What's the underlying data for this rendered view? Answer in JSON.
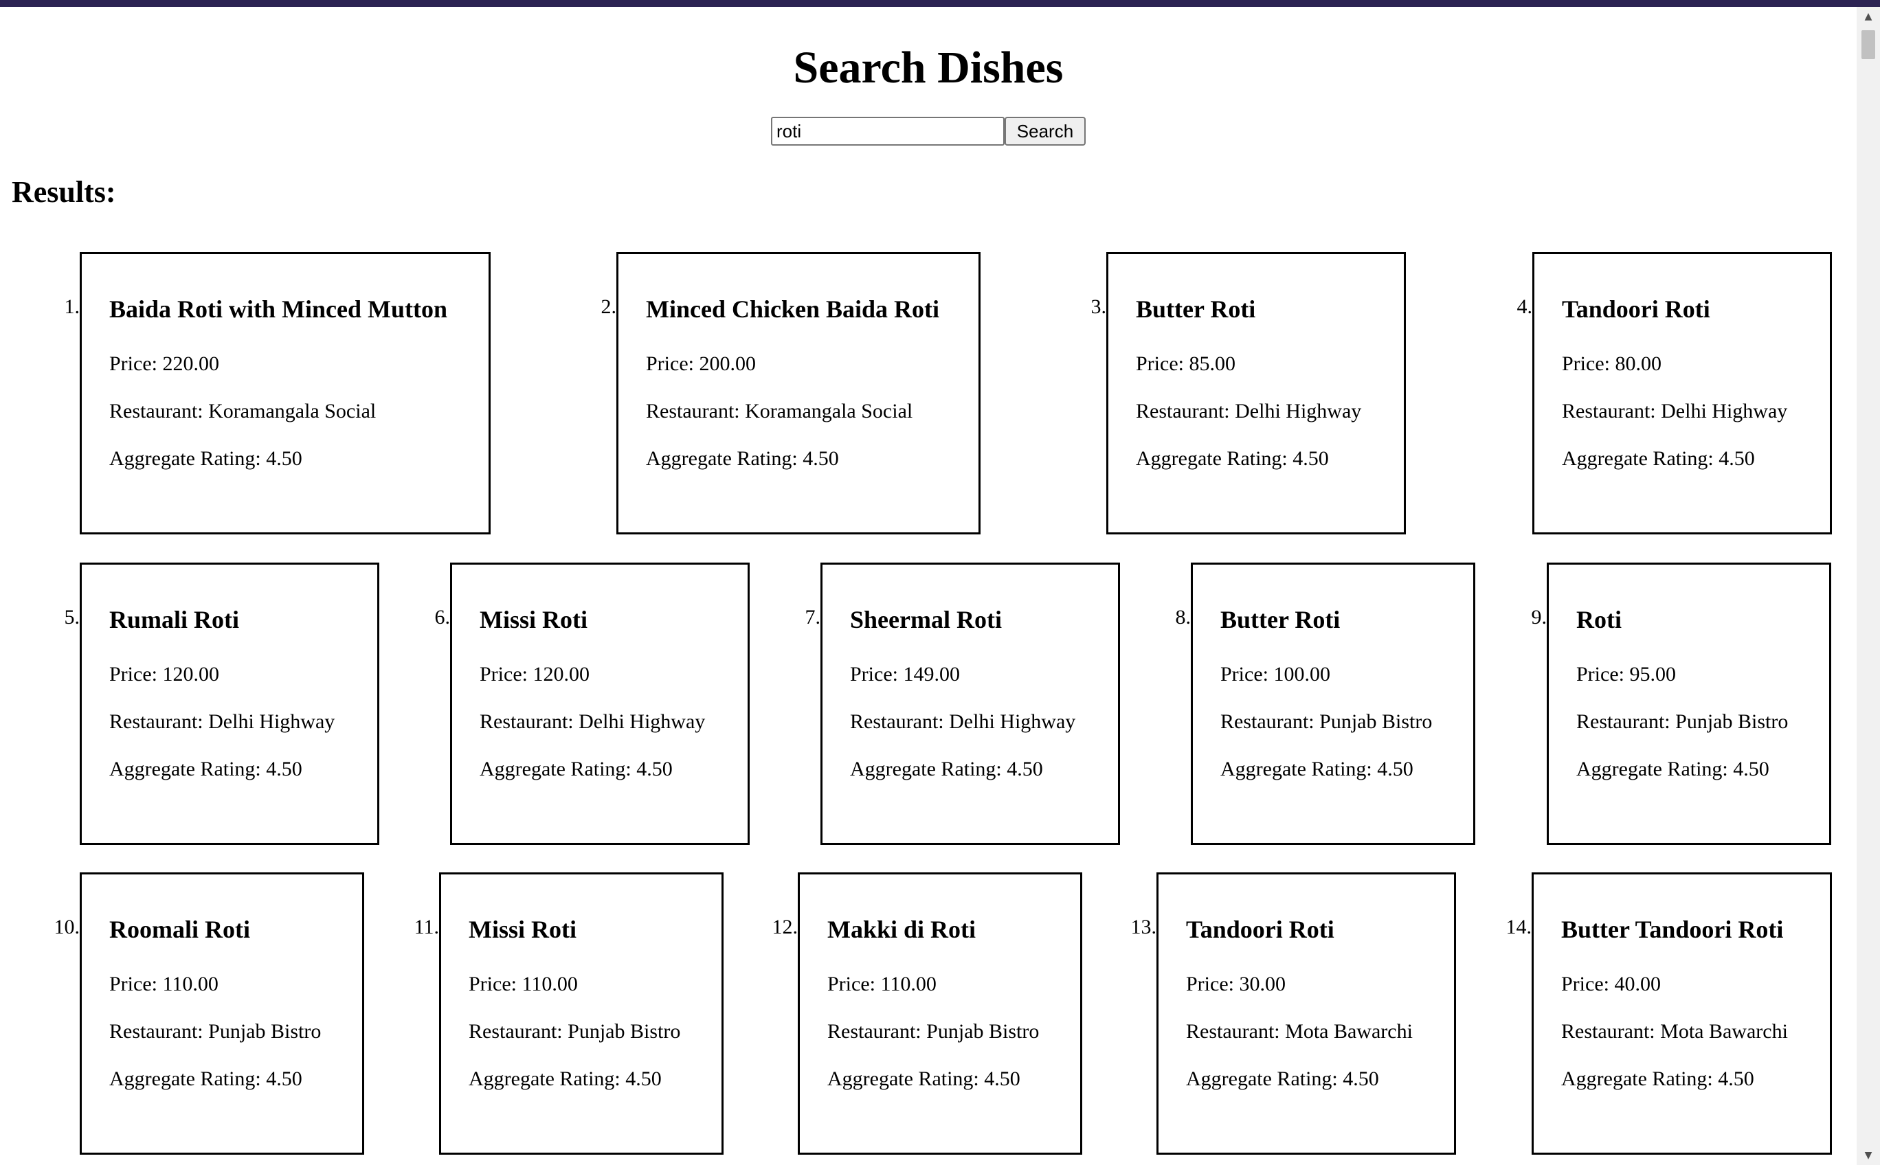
{
  "page": {
    "title": "Search Dishes",
    "results_heading": "Results:"
  },
  "search": {
    "value": "roti",
    "button_label": "Search"
  },
  "labels": {
    "price": "Price: ",
    "restaurant": "Restaurant: ",
    "rating": "Aggregate Rating: "
  },
  "colors": {
    "top_bar": "#2c2353"
  },
  "results": [
    {
      "num": "1.",
      "name": "Baida Roti with Minced Mutton",
      "price": "220.00",
      "restaurant": "Koramangala Social",
      "rating": "4.50"
    },
    {
      "num": "2.",
      "name": "Minced Chicken Baida Roti",
      "price": "200.00",
      "restaurant": "Koramangala Social",
      "rating": "4.50"
    },
    {
      "num": "3.",
      "name": "Butter Roti",
      "price": "85.00",
      "restaurant": "Delhi Highway",
      "rating": "4.50"
    },
    {
      "num": "4.",
      "name": "Tandoori Roti",
      "price": "80.00",
      "restaurant": "Delhi Highway",
      "rating": "4.50"
    },
    {
      "num": "5.",
      "name": "Rumali Roti",
      "price": "120.00",
      "restaurant": "Delhi Highway",
      "rating": "4.50"
    },
    {
      "num": "6.",
      "name": "Missi Roti",
      "price": "120.00",
      "restaurant": "Delhi Highway",
      "rating": "4.50"
    },
    {
      "num": "7.",
      "name": "Sheermal Roti",
      "price": "149.00",
      "restaurant": "Delhi Highway",
      "rating": "4.50"
    },
    {
      "num": "8.",
      "name": "Butter Roti",
      "price": "100.00",
      "restaurant": "Punjab Bistro",
      "rating": "4.50"
    },
    {
      "num": "9.",
      "name": "Roti",
      "price": "95.00",
      "restaurant": "Punjab Bistro",
      "rating": "4.50"
    },
    {
      "num": "10.",
      "name": "Roomali Roti",
      "price": "110.00",
      "restaurant": "Punjab Bistro",
      "rating": "4.50"
    },
    {
      "num": "11.",
      "name": "Missi Roti",
      "price": "110.00",
      "restaurant": "Punjab Bistro",
      "rating": "4.50"
    },
    {
      "num": "12.",
      "name": "Makki di Roti",
      "price": "110.00",
      "restaurant": "Punjab Bistro",
      "rating": "4.50"
    },
    {
      "num": "13.",
      "name": "Tandoori Roti",
      "price": "30.00",
      "restaurant": "Mota Bawarchi",
      "rating": "4.50"
    },
    {
      "num": "14.",
      "name": "Butter Tandoori Roti",
      "price": "40.00",
      "restaurant": "Mota Bawarchi",
      "rating": "4.50"
    }
  ]
}
